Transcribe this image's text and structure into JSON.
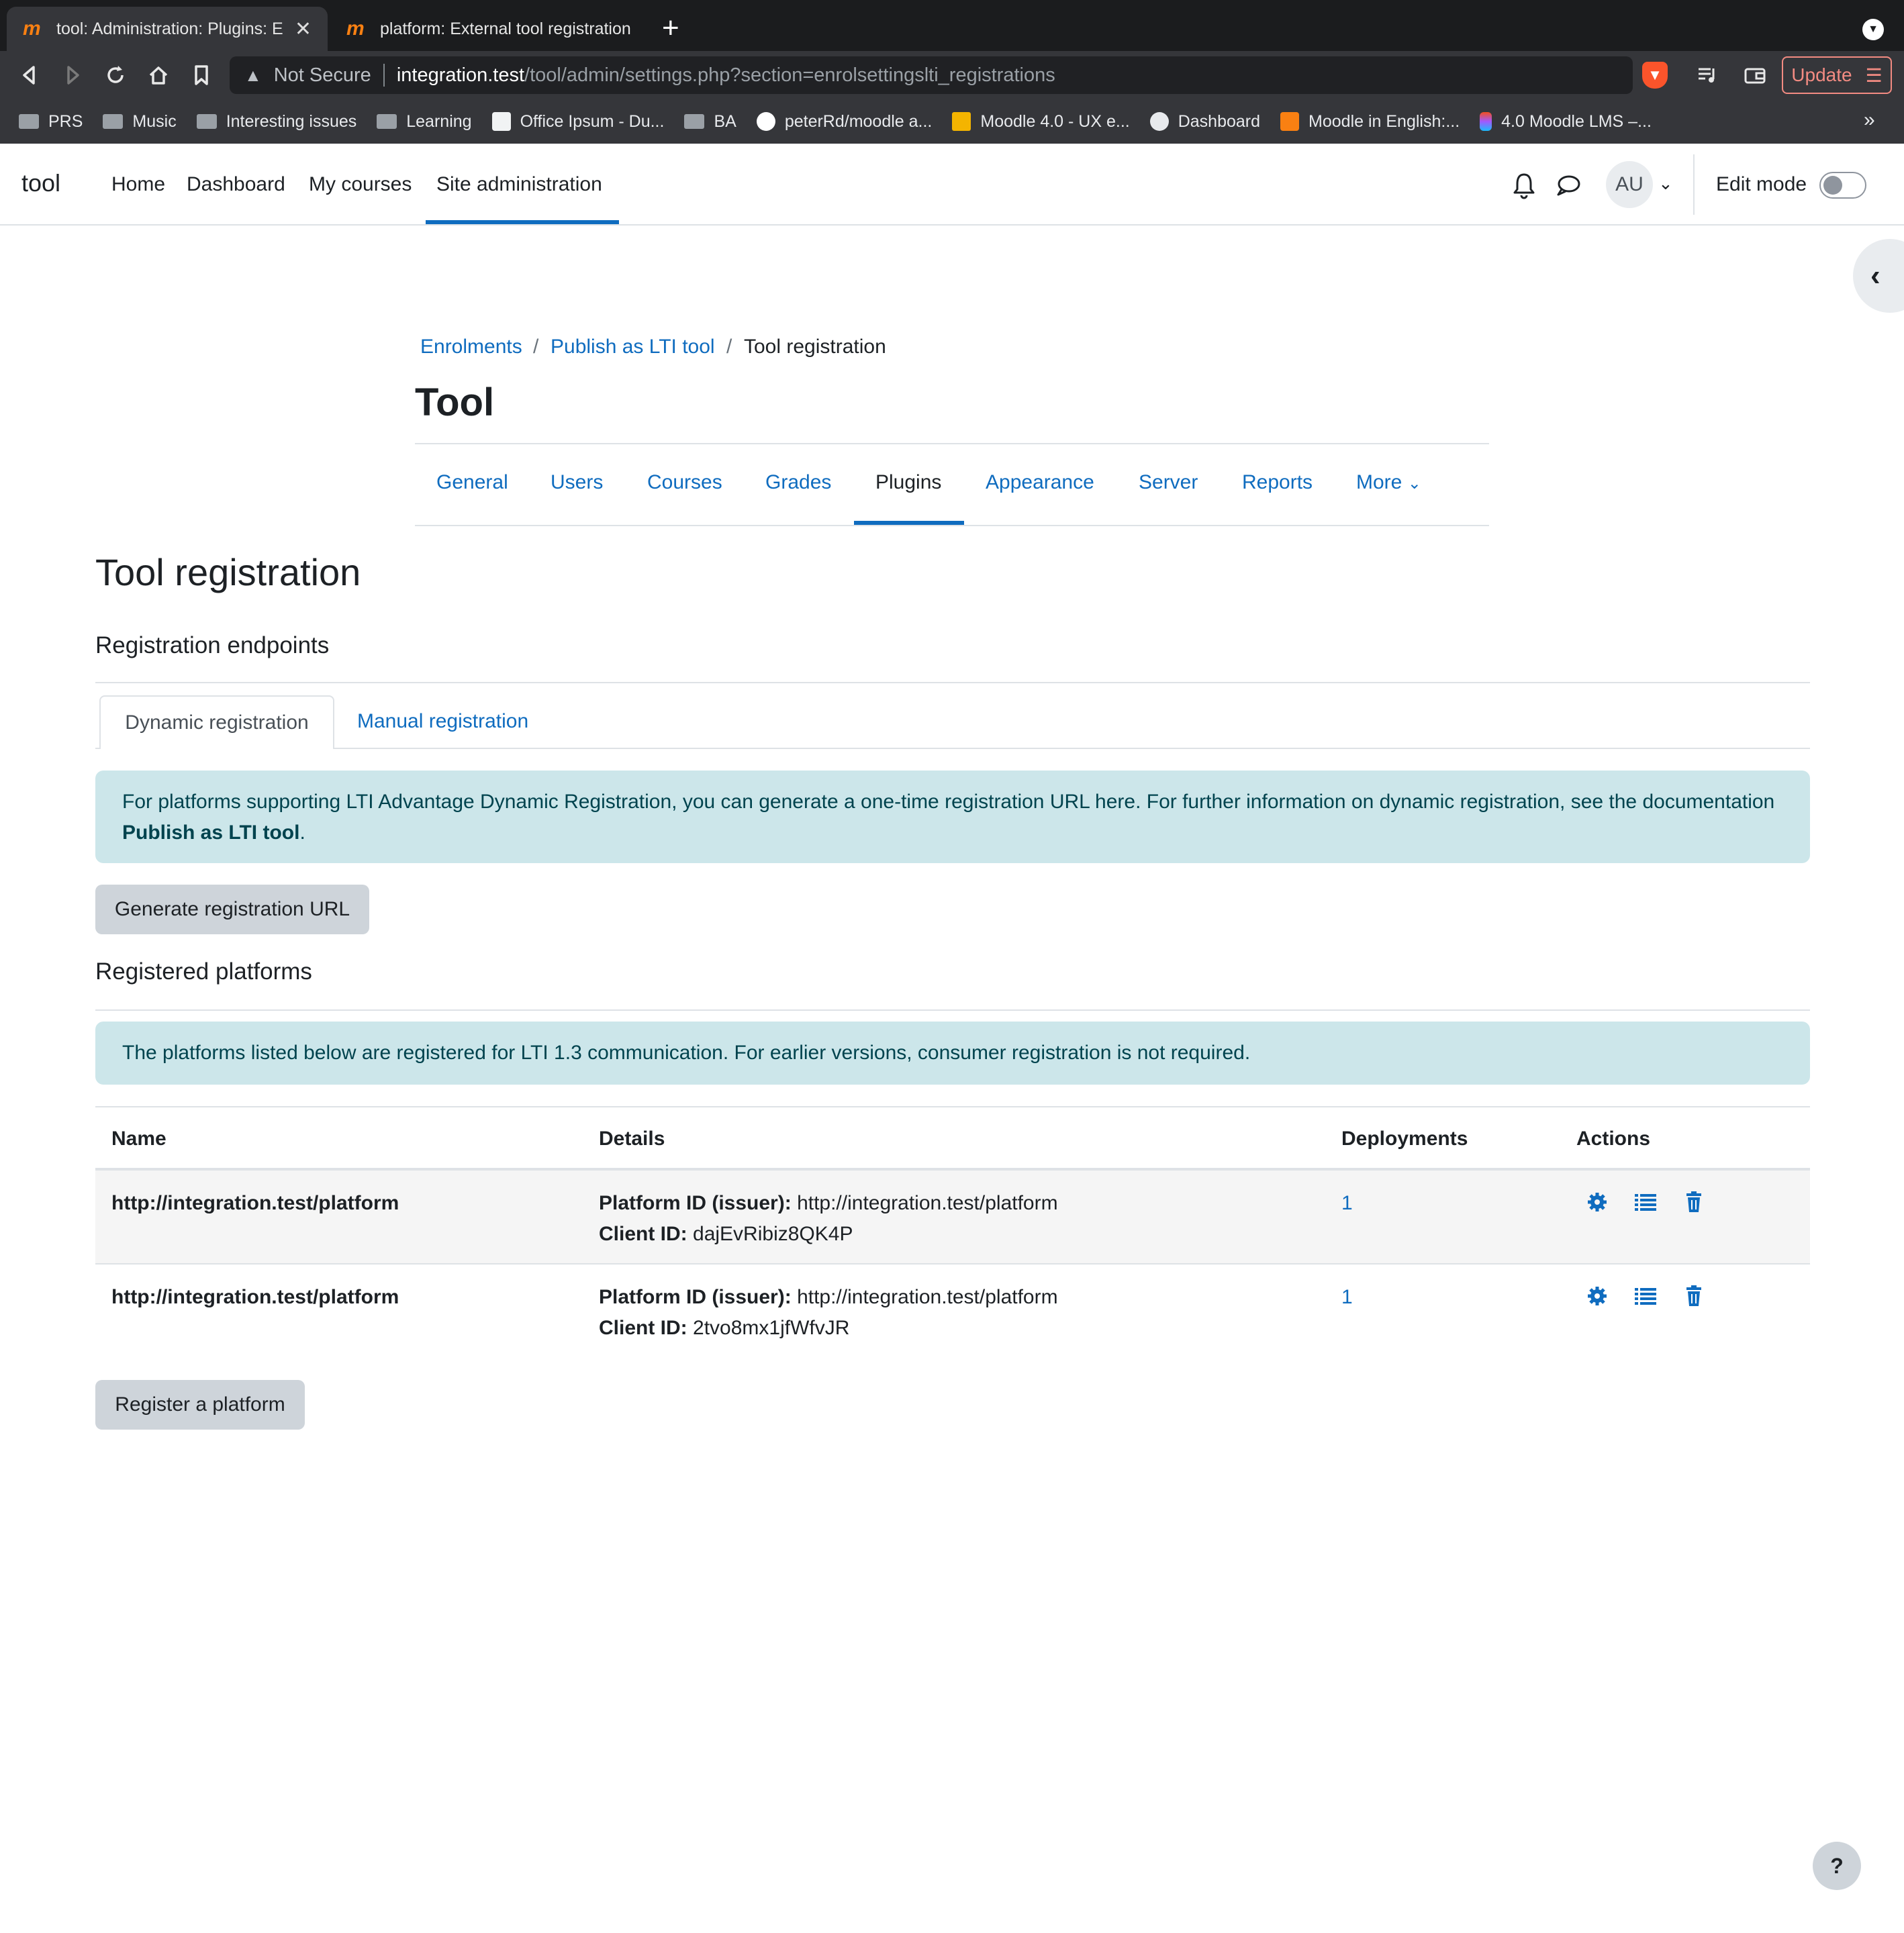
{
  "browser": {
    "tabs": [
      {
        "title": "tool: Administration: Plugins: Enrolments",
        "active": true
      },
      {
        "title": "platform: External tool registration",
        "active": false
      }
    ],
    "address": {
      "security_label": "Not Secure",
      "host": "integration.test",
      "path": "/tool/admin/settings.php?section=enrolsettingslti_registrations"
    },
    "update_label": "Update",
    "bookmarks": [
      {
        "label": "PRS",
        "icon": "folder-icon"
      },
      {
        "label": "Music",
        "icon": "folder-icon"
      },
      {
        "label": "Interesting issues",
        "icon": "folder-icon"
      },
      {
        "label": "Learning",
        "icon": "folder-icon"
      },
      {
        "label": "Office Ipsum - Du...",
        "icon": "coffee-icon"
      },
      {
        "label": "BA",
        "icon": "folder-icon"
      },
      {
        "label": "peterRd/moodle a...",
        "icon": "github-icon"
      },
      {
        "label": "Moodle 4.0 - UX e...",
        "icon": "slides-icon"
      },
      {
        "label": "Dashboard",
        "icon": "globe-icon"
      },
      {
        "label": "Moodle in English:...",
        "icon": "moodle-icon"
      },
      {
        "label": "4.0 Moodle LMS –...",
        "icon": "figma-icon"
      }
    ],
    "bookmarks_more": "»"
  },
  "header": {
    "site_name": "tool",
    "nav": [
      "Home",
      "Dashboard",
      "My courses",
      "Site administration"
    ],
    "active_nav": "Site administration",
    "avatar_initials": "AU",
    "edit_mode_label": "Edit mode",
    "edit_mode_on": false
  },
  "breadcrumb": [
    "Enrolments",
    "Publish as LTI tool",
    "Tool registration"
  ],
  "page_title": "Tool",
  "secondary_nav": [
    "General",
    "Users",
    "Courses",
    "Grades",
    "Plugins",
    "Appearance",
    "Server",
    "Reports",
    "More"
  ],
  "secondary_active": "Plugins",
  "content": {
    "heading": "Tool registration",
    "endpoints_heading": "Registration endpoints",
    "tabs": {
      "dynamic": "Dynamic registration",
      "manual": "Manual registration"
    },
    "dynamic_info_text": "For platforms supporting LTI Advantage Dynamic Registration, you can generate a one-time registration URL here. For further information on dynamic registration, see the documentation",
    "dynamic_info_link": "Publish as LTI tool",
    "dynamic_info_end": ".",
    "generate_button": "Generate registration URL",
    "registered_heading": "Registered platforms",
    "registered_info": "The platforms listed below are registered for LTI 1.3 communication. For earlier versions, consumer registration is not required.",
    "table": {
      "headers": [
        "Name",
        "Details",
        "Deployments",
        "Actions"
      ],
      "platform_id_label": "Platform ID (issuer):",
      "client_id_label": "Client ID:",
      "rows": [
        {
          "name": "http://integration.test/platform",
          "platform_id": "http://integration.test/platform",
          "client_id": "dajEvRibiz8QK4P",
          "deployments": "1"
        },
        {
          "name": "http://integration.test/platform",
          "platform_id": "http://integration.test/platform",
          "client_id": "2tvo8mx1jfWfvJR",
          "deployments": "1"
        }
      ]
    },
    "register_button": "Register a platform"
  },
  "help_label": "?",
  "colors": {
    "link": "#0f6cbf",
    "alert_bg": "#cce6ea",
    "alert_text": "#00434e",
    "button_secondary": "#ced4da"
  }
}
